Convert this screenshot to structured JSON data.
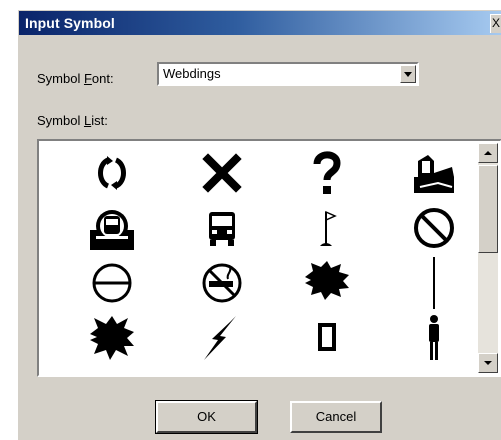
{
  "dialog": {
    "title": "Input Symbol",
    "close_label": "X"
  },
  "font_field": {
    "label_prefix": "Symbol ",
    "label_mnemonic": "F",
    "label_suffix": "ont:",
    "value": "Webdings"
  },
  "list_field": {
    "label_prefix": "Symbol ",
    "label_mnemonic": "L",
    "label_suffix": "ist:"
  },
  "symbols": [
    {
      "name": "circular-arrows-icon"
    },
    {
      "name": "x-mark-icon"
    },
    {
      "name": "question-mark-icon"
    },
    {
      "name": "hand-ticket-icon"
    },
    {
      "name": "subway-train-icon"
    },
    {
      "name": "bus-icon"
    },
    {
      "name": "golf-flag-icon"
    },
    {
      "name": "prohibited-icon"
    },
    {
      "name": "no-entry-icon"
    },
    {
      "name": "no-smoking-icon"
    },
    {
      "name": "explosion-burst-icon"
    },
    {
      "name": "vertical-line-icon"
    },
    {
      "name": "explosion-burst-icon"
    },
    {
      "name": "lightning-bolt-icon"
    },
    {
      "name": "rectangle-outline-icon"
    },
    {
      "name": "man-figure-icon"
    }
  ],
  "buttons": {
    "ok": "OK",
    "cancel": "Cancel"
  },
  "colors": {
    "title_bar_start": "#0a246a",
    "title_bar_end": "#a6caf0",
    "dialog_face": "#d4d0c8"
  }
}
